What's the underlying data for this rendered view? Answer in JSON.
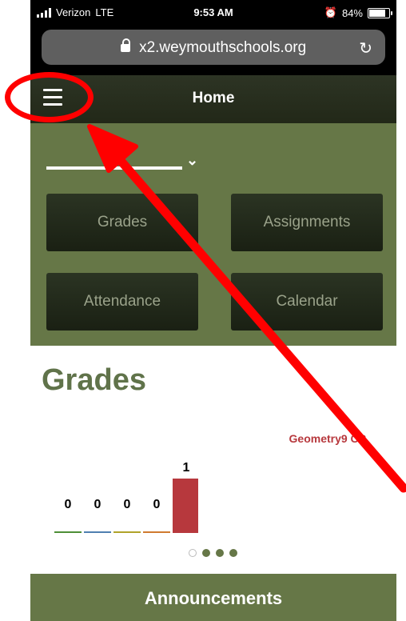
{
  "status": {
    "carrier": "Verizon",
    "network": "LTE",
    "time": "9:53 AM",
    "battery": "84%",
    "battery_level": 0.84
  },
  "browser": {
    "url": "x2.weymouthschools.org"
  },
  "header": {
    "title": "Home"
  },
  "dashboard": {
    "tiles": [
      "Grades",
      "Assignments",
      "Attendance",
      "Calendar"
    ]
  },
  "grades": {
    "heading": "Grades",
    "course": "Geometry9 CP",
    "counts": [
      "0",
      "0",
      "0",
      "0",
      "1"
    ],
    "legend_colors": [
      "#4e8f37",
      "#4f7fb0",
      "#b0a32a",
      "#d07a2f"
    ],
    "bar_color": "#b7383d"
  },
  "announcements": {
    "label": "Announcements"
  },
  "colors": {
    "dashboard_green": "#667747",
    "header_dark": "#262d1d",
    "annotation_red": "#ff0000"
  }
}
